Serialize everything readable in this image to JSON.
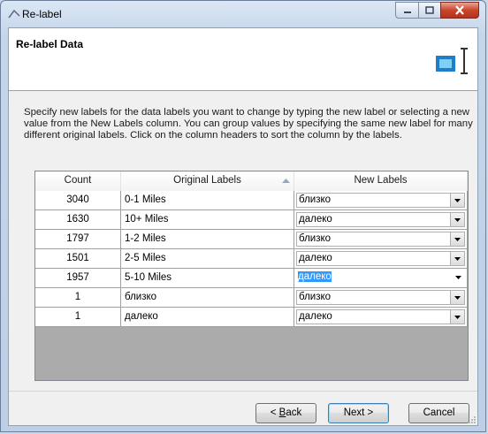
{
  "window": {
    "title": "Re-label"
  },
  "header": {
    "title": "Re-label Data"
  },
  "description": "Specify new labels for the data labels you want to change by typing the new label or selecting a new value from the New Labels column. You can group values by specifying the same new label for many different original labels.  Click on the column headers to sort the column by the labels.",
  "grid": {
    "columns": {
      "count": "Count",
      "original": "Original Labels",
      "new": "New Labels"
    },
    "sort_column": "Original Labels",
    "rows": [
      {
        "count": "3040",
        "original": "0-1 Miles",
        "new": "близко"
      },
      {
        "count": "1630",
        "original": "10+ Miles",
        "new": "далеко"
      },
      {
        "count": "1797",
        "original": "1-2 Miles",
        "new": "близко"
      },
      {
        "count": "1501",
        "original": "2-5 Miles",
        "new": "далеко"
      },
      {
        "count": "1957",
        "original": "5-10 Miles",
        "new": "далеко"
      },
      {
        "count": "1",
        "original": "близко",
        "new": "близко"
      },
      {
        "count": "1",
        "original": "далеко",
        "new": "далеко"
      }
    ],
    "editing_row_index": 4
  },
  "buttons": {
    "back_pre": "< ",
    "back_u": "B",
    "back_post": "ack",
    "next": "Next >",
    "cancel": "Cancel"
  },
  "colors": {
    "selection": "#3399ff",
    "close_button": "#c9462c",
    "accent": "#1e7ec8"
  }
}
